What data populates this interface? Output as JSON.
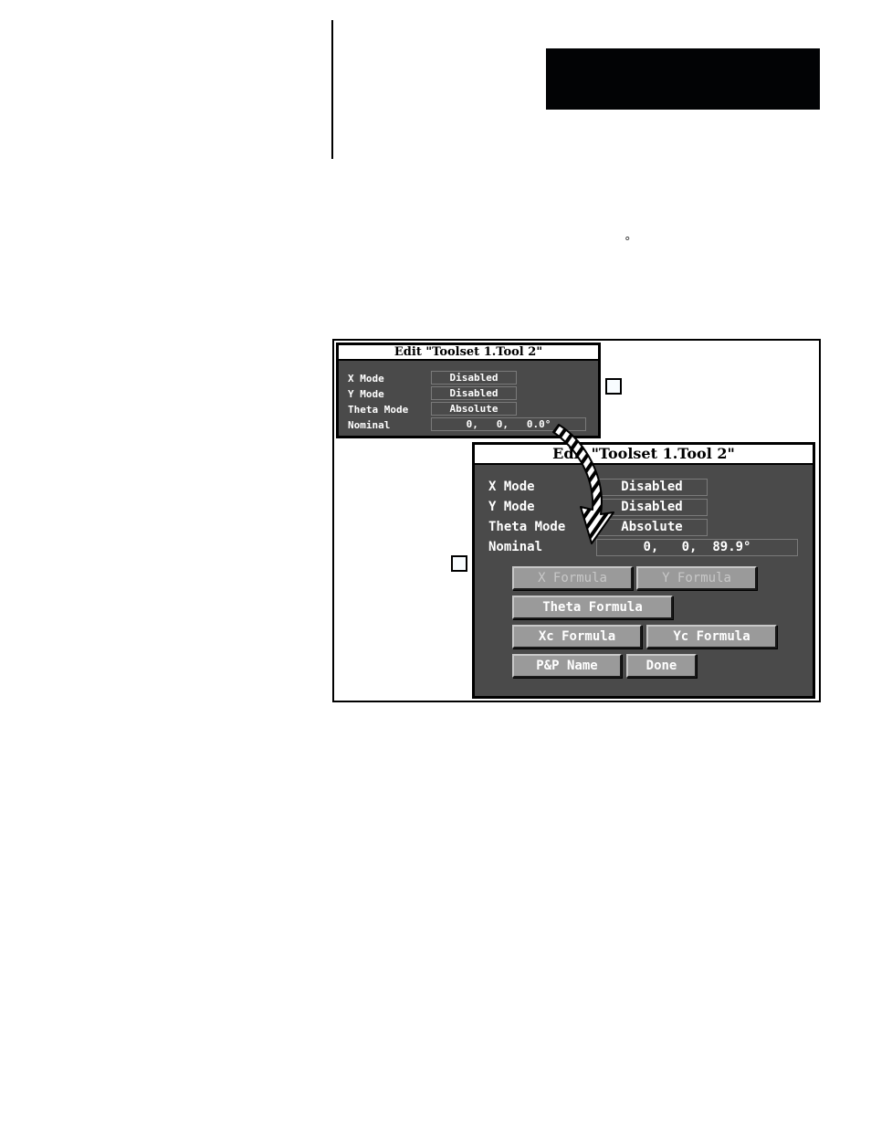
{
  "page": {
    "degree_symbol": "°"
  },
  "small_dialog": {
    "title": "Edit \"Toolset 1.Tool 2\"",
    "fields": [
      {
        "label": "X Mode",
        "value": "Disabled"
      },
      {
        "label": "Y Mode",
        "value": "Disabled"
      },
      {
        "label": "Theta Mode",
        "value": "Absolute"
      },
      {
        "label": "Nominal",
        "value": "0,   0,   0.0°"
      }
    ]
  },
  "large_dialog": {
    "title": "Edit \"Toolset 1.Tool 2\"",
    "fields": [
      {
        "label": "X Mode",
        "value": "Disabled"
      },
      {
        "label": "Y Mode",
        "value": "Disabled"
      },
      {
        "label": "Theta Mode",
        "value": "Absolute"
      },
      {
        "label": "Nominal",
        "value": "0,   0,  89.9°"
      }
    ],
    "buttons": {
      "x_formula": {
        "label": "X Formula",
        "enabled": false
      },
      "y_formula": {
        "label": "Y Formula",
        "enabled": false
      },
      "theta_formula": {
        "label": "Theta Formula",
        "enabled": true
      },
      "xc_formula": {
        "label": "Xc Formula",
        "enabled": true
      },
      "yc_formula": {
        "label": "Yc Formula",
        "enabled": true
      },
      "pp_name": {
        "label": "P&P Name",
        "enabled": true
      },
      "done": {
        "label": "Done",
        "enabled": true
      }
    }
  },
  "colors": {
    "dialog_bg": "#4a4a4a",
    "button_face": "#9a9a9a",
    "title_bg": "#ffffff",
    "header_block": "#020305"
  }
}
